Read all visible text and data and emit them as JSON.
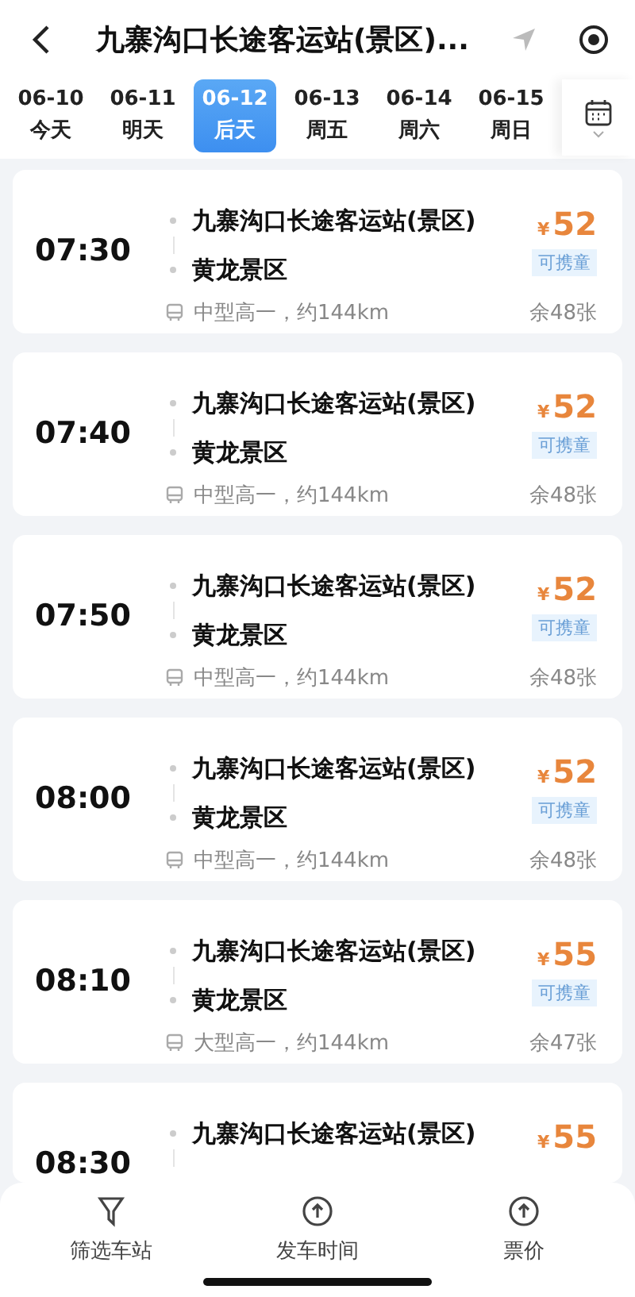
{
  "header": {
    "title": "九寨沟口长途客运站(景区)..."
  },
  "dates": [
    {
      "date": "06-10",
      "day": "今天",
      "selected": false
    },
    {
      "date": "06-11",
      "day": "明天",
      "selected": false
    },
    {
      "date": "06-12",
      "day": "后天",
      "selected": true
    },
    {
      "date": "06-13",
      "day": "周五",
      "selected": false
    },
    {
      "date": "06-14",
      "day": "周六",
      "selected": false
    },
    {
      "date": "06-15",
      "day": "周日",
      "selected": false
    }
  ],
  "trips": [
    {
      "time": "07:30",
      "from": "九寨沟口长途客运站(景区)",
      "to": "黄龙景区",
      "currency": "¥",
      "price": "52",
      "tag": "可携童",
      "info": "中型高一，约144km",
      "seats": "余48张"
    },
    {
      "time": "07:40",
      "from": "九寨沟口长途客运站(景区)",
      "to": "黄龙景区",
      "currency": "¥",
      "price": "52",
      "tag": "可携童",
      "info": "中型高一，约144km",
      "seats": "余48张"
    },
    {
      "time": "07:50",
      "from": "九寨沟口长途客运站(景区)",
      "to": "黄龙景区",
      "currency": "¥",
      "price": "52",
      "tag": "可携童",
      "info": "中型高一，约144km",
      "seats": "余48张"
    },
    {
      "time": "08:00",
      "from": "九寨沟口长途客运站(景区)",
      "to": "黄龙景区",
      "currency": "¥",
      "price": "52",
      "tag": "可携童",
      "info": "中型高一，约144km",
      "seats": "余48张"
    },
    {
      "time": "08:10",
      "from": "九寨沟口长途客运站(景区)",
      "to": "黄龙景区",
      "currency": "¥",
      "price": "55",
      "tag": "可携童",
      "info": "大型高一，约144km",
      "seats": "余47张"
    },
    {
      "time": "08:30",
      "from": "九寨沟口长途客运站(景区)",
      "currency": "¥",
      "price": "55"
    }
  ],
  "bottom_bar": [
    {
      "kind": "filter",
      "label": "筛选车站"
    },
    {
      "kind": "sort",
      "label": "发车时间"
    },
    {
      "kind": "sort",
      "label": "票价"
    }
  ]
}
